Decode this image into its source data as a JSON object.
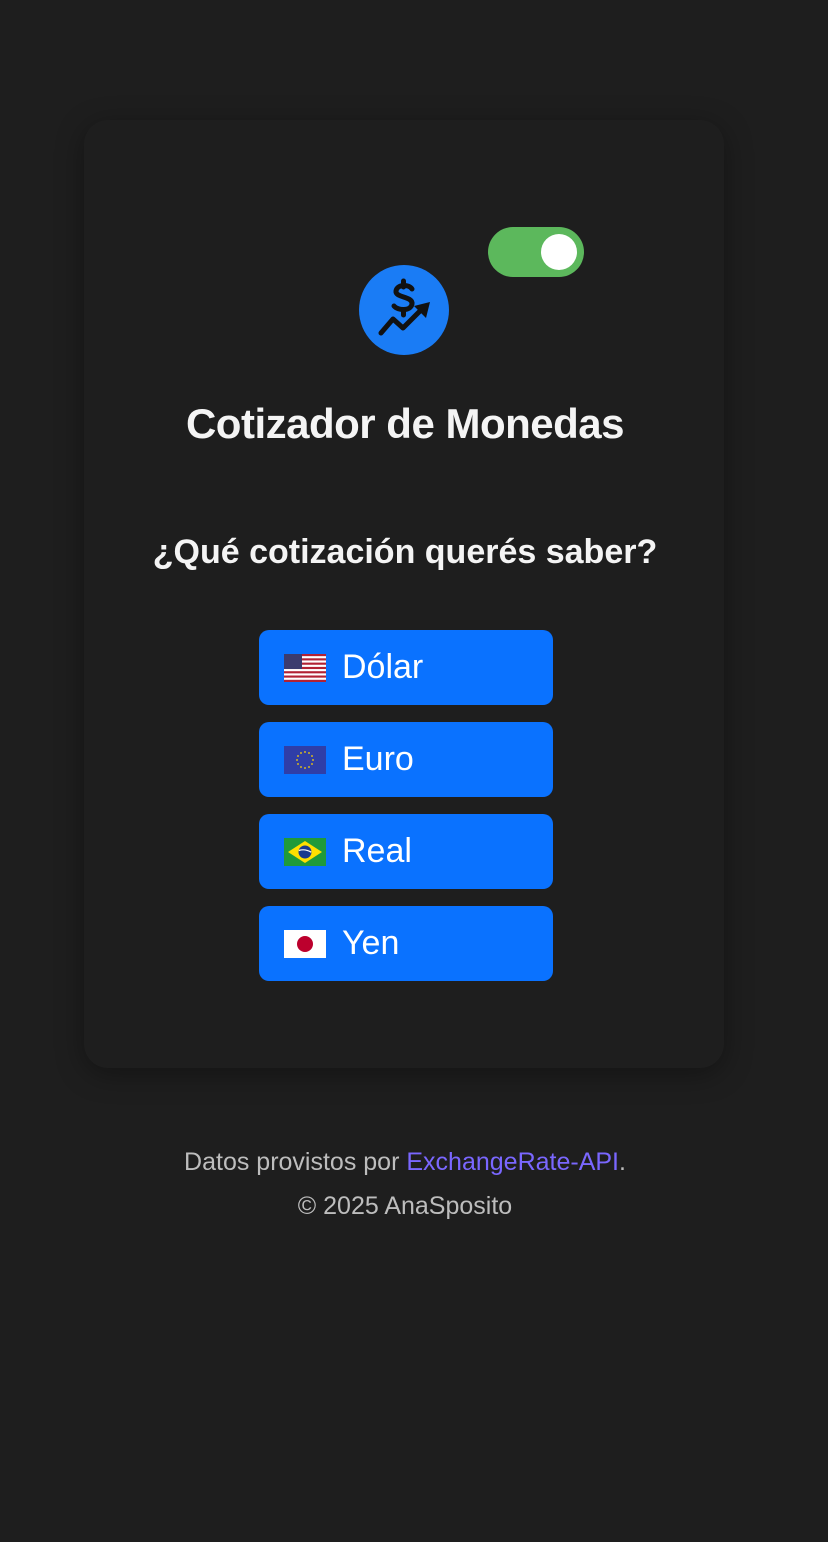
{
  "app": {
    "title": "Cotizador de Monedas",
    "question": "¿Qué cotización querés saber?",
    "theme_toggle_on": true,
    "logo_icon": "dollar-trend-icon"
  },
  "currencies": [
    {
      "label": "Dólar",
      "flag_icon": "us-flag-icon"
    },
    {
      "label": "Euro",
      "flag_icon": "eu-flag-icon"
    },
    {
      "label": "Real",
      "flag_icon": "brazil-flag-icon"
    },
    {
      "label": "Yen",
      "flag_icon": "japan-flag-icon"
    }
  ],
  "footer": {
    "data_prefix": "Datos provistos por ",
    "provider_link": "ExchangeRate-API",
    "data_suffix": ".",
    "copyright": "© 2025 AnaSposito"
  },
  "colors": {
    "background": "#1e1e1e",
    "accent": "#0a72ff",
    "toggle_on": "#5cb85c",
    "link": "#7a67ff"
  }
}
